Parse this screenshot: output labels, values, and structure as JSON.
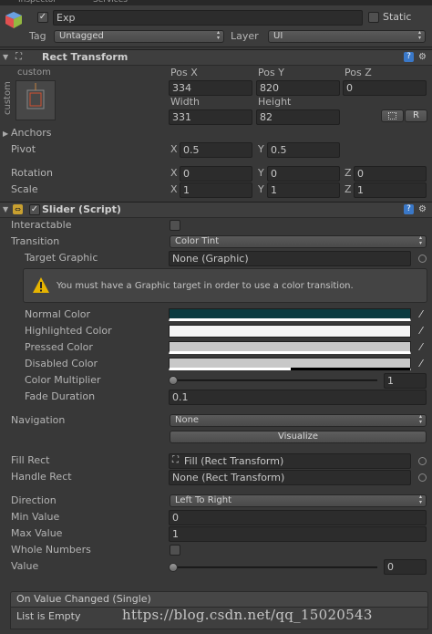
{
  "tabs": {
    "inspector": "Inspector",
    "services": "Services"
  },
  "gameobject": {
    "name": "Exp",
    "static_label": "Static",
    "tag_label": "Tag",
    "tag_value": "Untagged",
    "layer_label": "Layer",
    "layer_value": "UI",
    "active": true,
    "is_static": false
  },
  "rect_transform": {
    "title": "Rect Transform",
    "anchor_preset_top": "custom",
    "anchor_preset_side": "custom",
    "pos_x_label": "Pos X",
    "pos_y_label": "Pos Y",
    "pos_z_label": "Pos Z",
    "pos_x": "334",
    "pos_y": "820",
    "pos_z": "0",
    "width_label": "Width",
    "height_label": "Height",
    "width": "331",
    "height": "82",
    "raw_btn": "R",
    "anchors_label": "Anchors",
    "pivot_label": "Pivot",
    "pivot_x": "0.5",
    "pivot_y": "0.5",
    "rotation_label": "Rotation",
    "rot_x": "0",
    "rot_y": "0",
    "rot_z": "0",
    "scale_label": "Scale",
    "scale_x": "1",
    "scale_y": "1",
    "scale_z": "1",
    "x": "X",
    "y": "Y",
    "z": "Z"
  },
  "slider": {
    "title": "Slider (Script)",
    "enabled": true,
    "interactable_label": "Interactable",
    "interactable": false,
    "transition_label": "Transition",
    "transition_value": "Color Tint",
    "target_graphic_label": "Target Graphic",
    "target_graphic_value": "None (Graphic)",
    "warning": "You must have a Graphic target in order to use a color transition.",
    "normal_color_label": "Normal Color",
    "highlighted_color_label": "Highlighted Color",
    "pressed_color_label": "Pressed Color",
    "disabled_color_label": "Disabled Color",
    "color_multiplier_label": "Color Multiplier",
    "color_multiplier_value": "1",
    "color_multiplier_fraction": 0,
    "fade_duration_label": "Fade Duration",
    "fade_duration_value": "0.1",
    "navigation_label": "Navigation",
    "navigation_value": "None",
    "visualize_btn": "Visualize",
    "fill_rect_label": "Fill Rect",
    "fill_rect_value": "Fill (Rect Transform)",
    "handle_rect_label": "Handle Rect",
    "handle_rect_value": "None (Rect Transform)",
    "direction_label": "Direction",
    "direction_value": "Left To Right",
    "min_value_label": "Min Value",
    "min_value": "0",
    "max_value_label": "Max Value",
    "max_value": "1",
    "whole_numbers_label": "Whole Numbers",
    "whole_numbers": false,
    "value_label": "Value",
    "value_value": "0",
    "value_fraction": 0
  },
  "colors": {
    "normal": "#0b3b40",
    "highlighted": "#f5f5f5",
    "pressed": "#c8c8c8",
    "disabled": "#c8c8c8",
    "accent_warning": "#e6b400",
    "panel_bg": "#383838"
  },
  "event": {
    "title": "On Value Changed (Single)",
    "empty_label": "List is Empty"
  },
  "watermark": "https://blog.csdn.net/qq_15020543"
}
